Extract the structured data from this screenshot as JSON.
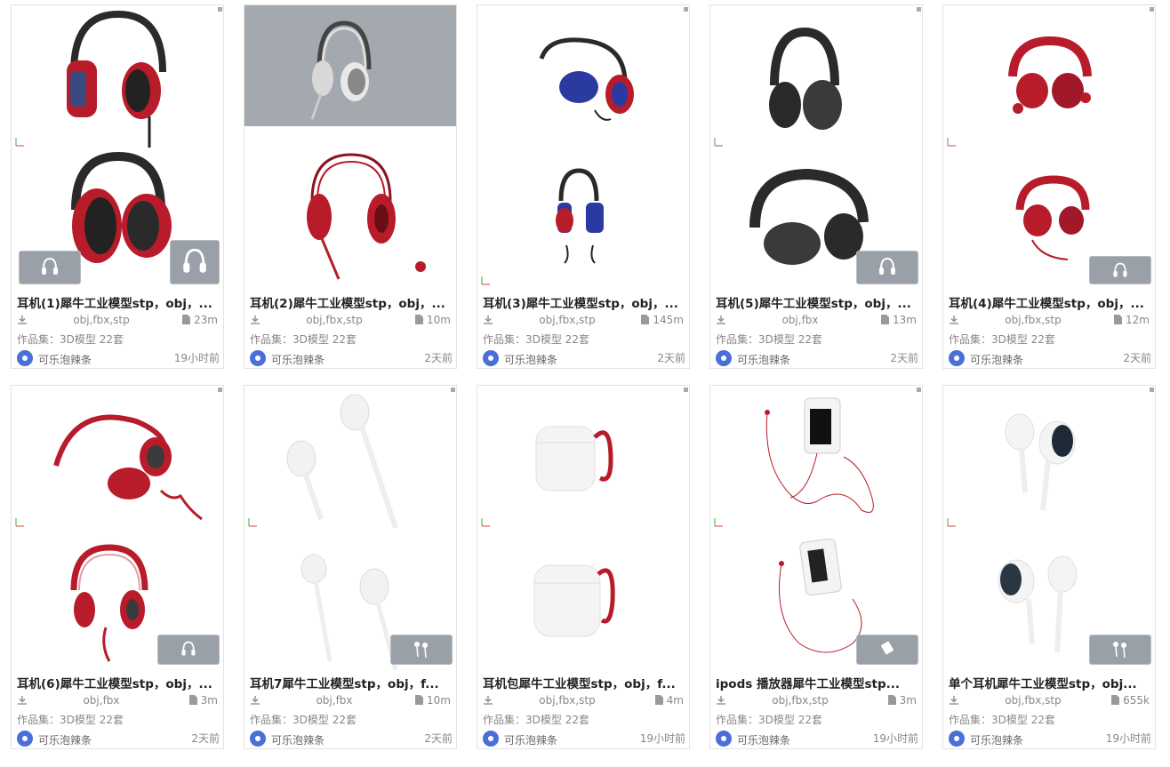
{
  "cards": [
    {
      "title": "耳机(1)犀牛工业模型stp，obj，...",
      "formats": "obj,fbx,stp",
      "size": "23m",
      "collection": "作品集：3D模型 22套",
      "author": "可乐泡辣条",
      "time": "19小时前",
      "thumb_icon": "red-over-ear-headphones-icon"
    },
    {
      "title": "耳机(2)犀牛工业模型stp，obj，...",
      "formats": "obj,fbx,stp",
      "size": "10m",
      "collection": "作品集：3D模型 22套",
      "author": "可乐泡辣条",
      "time": "2天前",
      "thumb_icon": "gaming-headset-icon"
    },
    {
      "title": "耳机(3)犀牛工业模型stp，obj，...",
      "formats": "obj,fbx,stp",
      "size": "145m",
      "collection": "作品集：3D模型 22套",
      "author": "可乐泡辣条",
      "time": "2天前",
      "thumb_icon": "blue-red-headphones-icon"
    },
    {
      "title": "耳机(5)犀牛工业模型stp，obj，...",
      "formats": "obj,fbx",
      "size": "13m",
      "collection": "作品集：3D模型 22套",
      "author": "可乐泡辣条",
      "time": "2天前",
      "thumb_icon": "black-headphones-icon"
    },
    {
      "title": "耳机(4)犀牛工业模型stp，obj，...",
      "formats": "obj,fbx,stp",
      "size": "12m",
      "collection": "作品集：3D模型 22套",
      "author": "可乐泡辣条",
      "time": "2天前",
      "thumb_icon": "red-folding-headphones-icon"
    },
    {
      "title": "耳机(6)犀牛工业模型stp，obj，...",
      "formats": "obj,fbx",
      "size": "3m",
      "collection": "作品集：3D模型 22套",
      "author": "可乐泡辣条",
      "time": "2天前",
      "thumb_icon": "red-dj-headphones-icon"
    },
    {
      "title": "耳机7犀牛工业模型stp，obj，f...",
      "formats": "obj,fbx",
      "size": "10m",
      "collection": "作品集：3D模型 22套",
      "author": "可乐泡辣条",
      "time": "2天前",
      "thumb_icon": "white-earbuds-icon"
    },
    {
      "title": "耳机包犀牛工业模型stp，obj，f...",
      "formats": "obj,fbx,stp",
      "size": "4m",
      "collection": "作品集：3D模型 22套",
      "author": "可乐泡辣条",
      "time": "19小时前",
      "thumb_icon": "earbud-case-icon"
    },
    {
      "title": "ipods 播放器犀牛工业模型stp...",
      "formats": "obj,fbx,stp",
      "size": "3m",
      "collection": "作品集：3D模型 22套",
      "author": "可乐泡辣条",
      "time": "19小时前",
      "thumb_icon": "ipod-player-icon"
    },
    {
      "title": "单个耳机犀牛工业模型stp，obj...",
      "formats": "obj,fbx,stp",
      "size": "655k",
      "collection": "作品集：3D模型 22套",
      "author": "可乐泡辣条",
      "time": "19小时前",
      "thumb_icon": "single-earbud-icon"
    }
  ],
  "colors": {
    "red": "#b81c2a",
    "blue": "#2a3aa0",
    "black": "#2a2a2a",
    "silver": "#c8c8c8",
    "badge": "#9aa0a8",
    "avatar": "#4a6fd8"
  }
}
